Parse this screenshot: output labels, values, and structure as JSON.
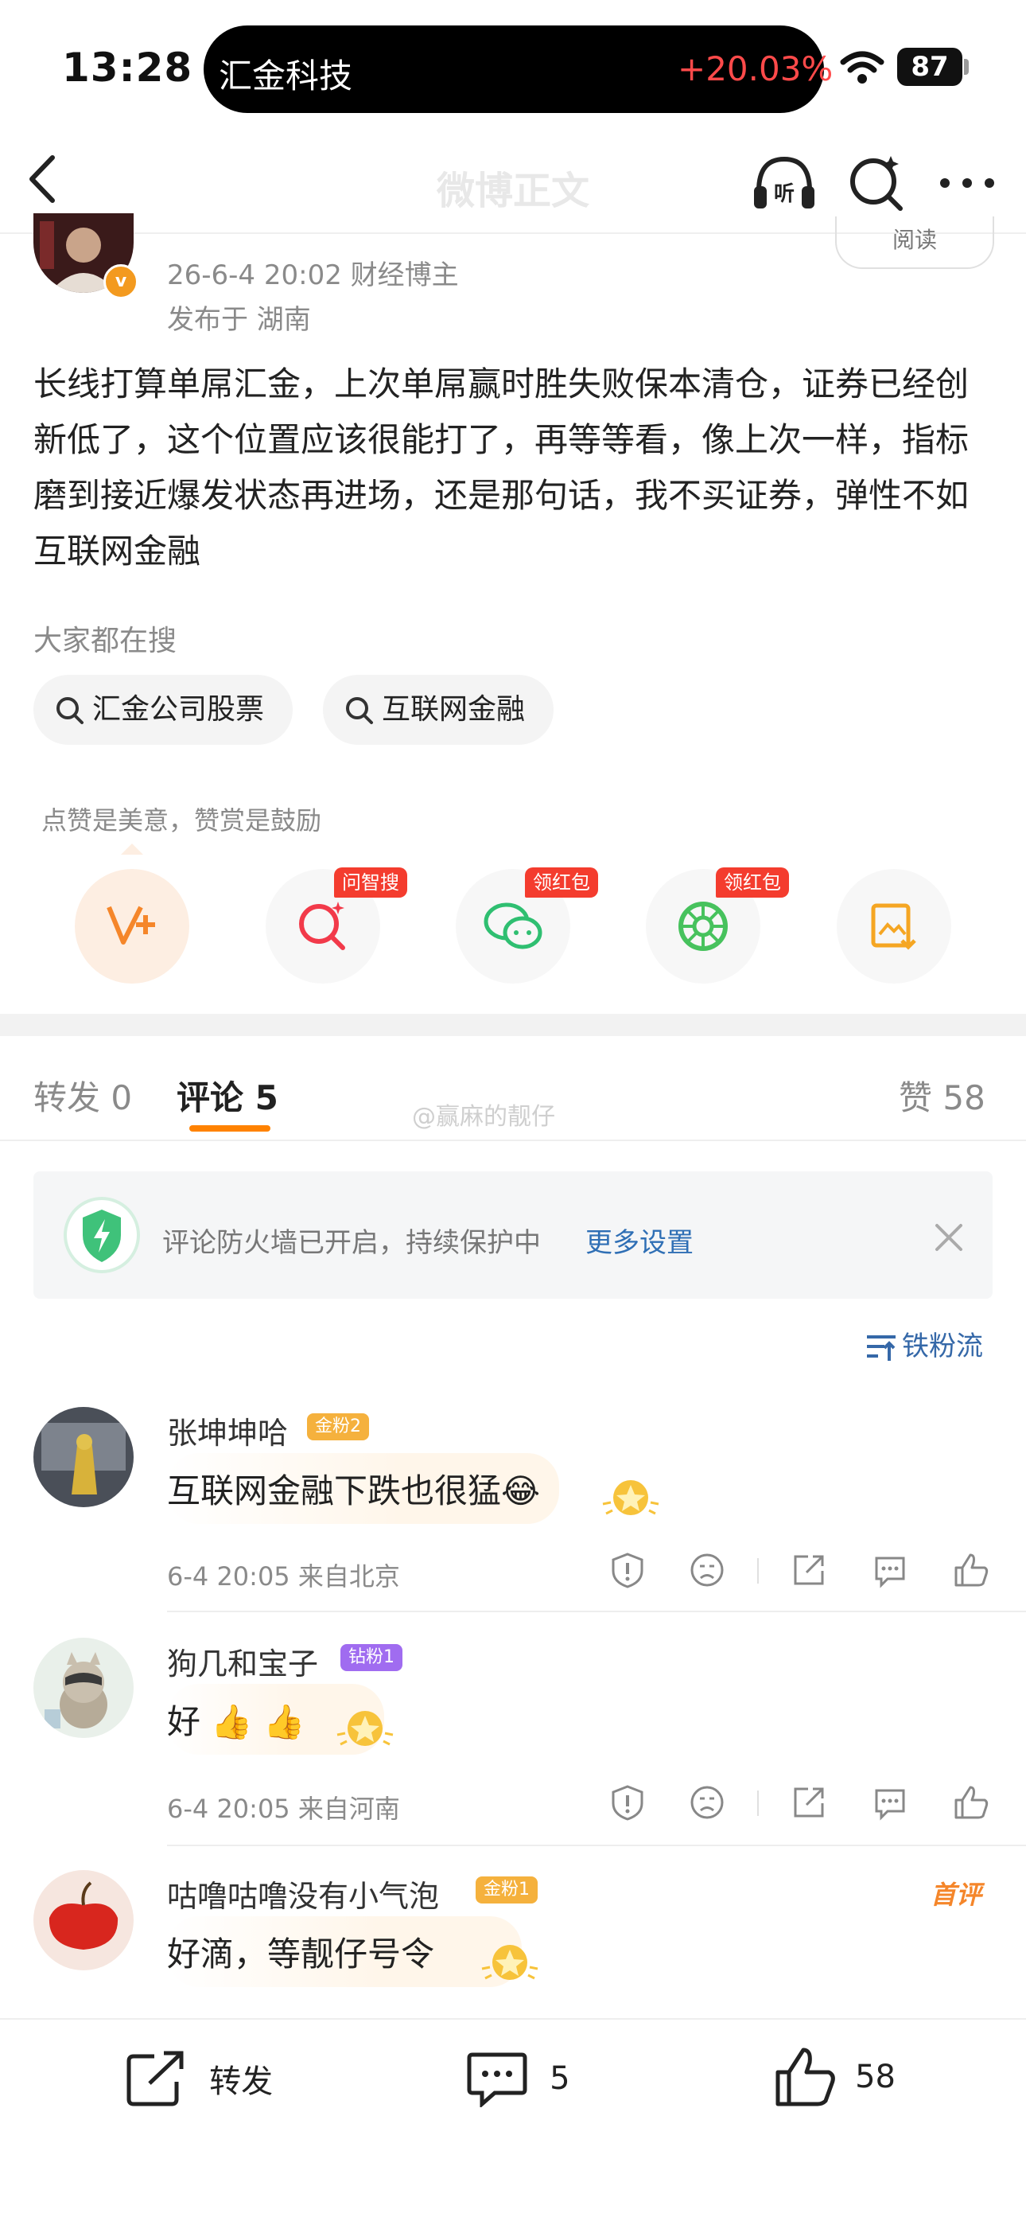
{
  "status_bar": {
    "time": "13:28",
    "island_title": "汇金科技",
    "island_change": "+20.03%",
    "battery": "87"
  },
  "nav": {
    "title": "微博正文"
  },
  "author": {
    "meta": "26-6-4 20:02  财经博主",
    "location": "发布于 湖南",
    "read_label": "阅读",
    "badge": "v"
  },
  "post": {
    "text": "长线打算单屌汇金，上次单屌赢时胜失败保本清仓，证券已经创新低了，这个位置应该很能打了，再等等看，像上次一样，指标磨到接近爆发状态再进场，还是那句话，我不买证券，弹性不如互联网金融"
  },
  "searching": {
    "label": "大家都在搜",
    "chips": [
      "汇金公司股票",
      "互联网金融"
    ]
  },
  "reward": {
    "tip": "点赞是美意，赞赏是鼓励",
    "badges": [
      "问智搜",
      "领红包",
      "领红包"
    ]
  },
  "tabs": {
    "repost": "转发 0",
    "comments": "评论 5",
    "likes": "赞 58",
    "watermark": "@赢麻的靓仔"
  },
  "firewall": {
    "text": "评论防火墙已开启，持续保护中",
    "link": "更多设置"
  },
  "sort_label": "铁粉流",
  "comments": [
    {
      "name": "张坤坤哈",
      "badge": "金粉2",
      "badge_color": "#f5b13d",
      "text": "互联网金融下跌也很猛",
      "emoji": "😂",
      "meta": "6-4 20:05  来自北京"
    },
    {
      "name": "狗几和宝子",
      "badge": "钻粉1",
      "badge_color": "#a06cf0",
      "text": "好",
      "emoji": "👍 👍",
      "meta": "6-4 20:05  来自河南"
    },
    {
      "name": "咕噜咕噜没有小气泡",
      "badge": "金粉1",
      "badge_color": "#f5b13d",
      "text": "好滴，等靓仔号令",
      "emoji": "",
      "meta": "",
      "tag": "首评"
    }
  ],
  "bottom_bar": {
    "repost": "转发",
    "comments": "5",
    "likes": "58"
  },
  "colors": {
    "accent": "#ff8200",
    "link": "#2f6fb5",
    "red_badge": "#f43c2e"
  }
}
